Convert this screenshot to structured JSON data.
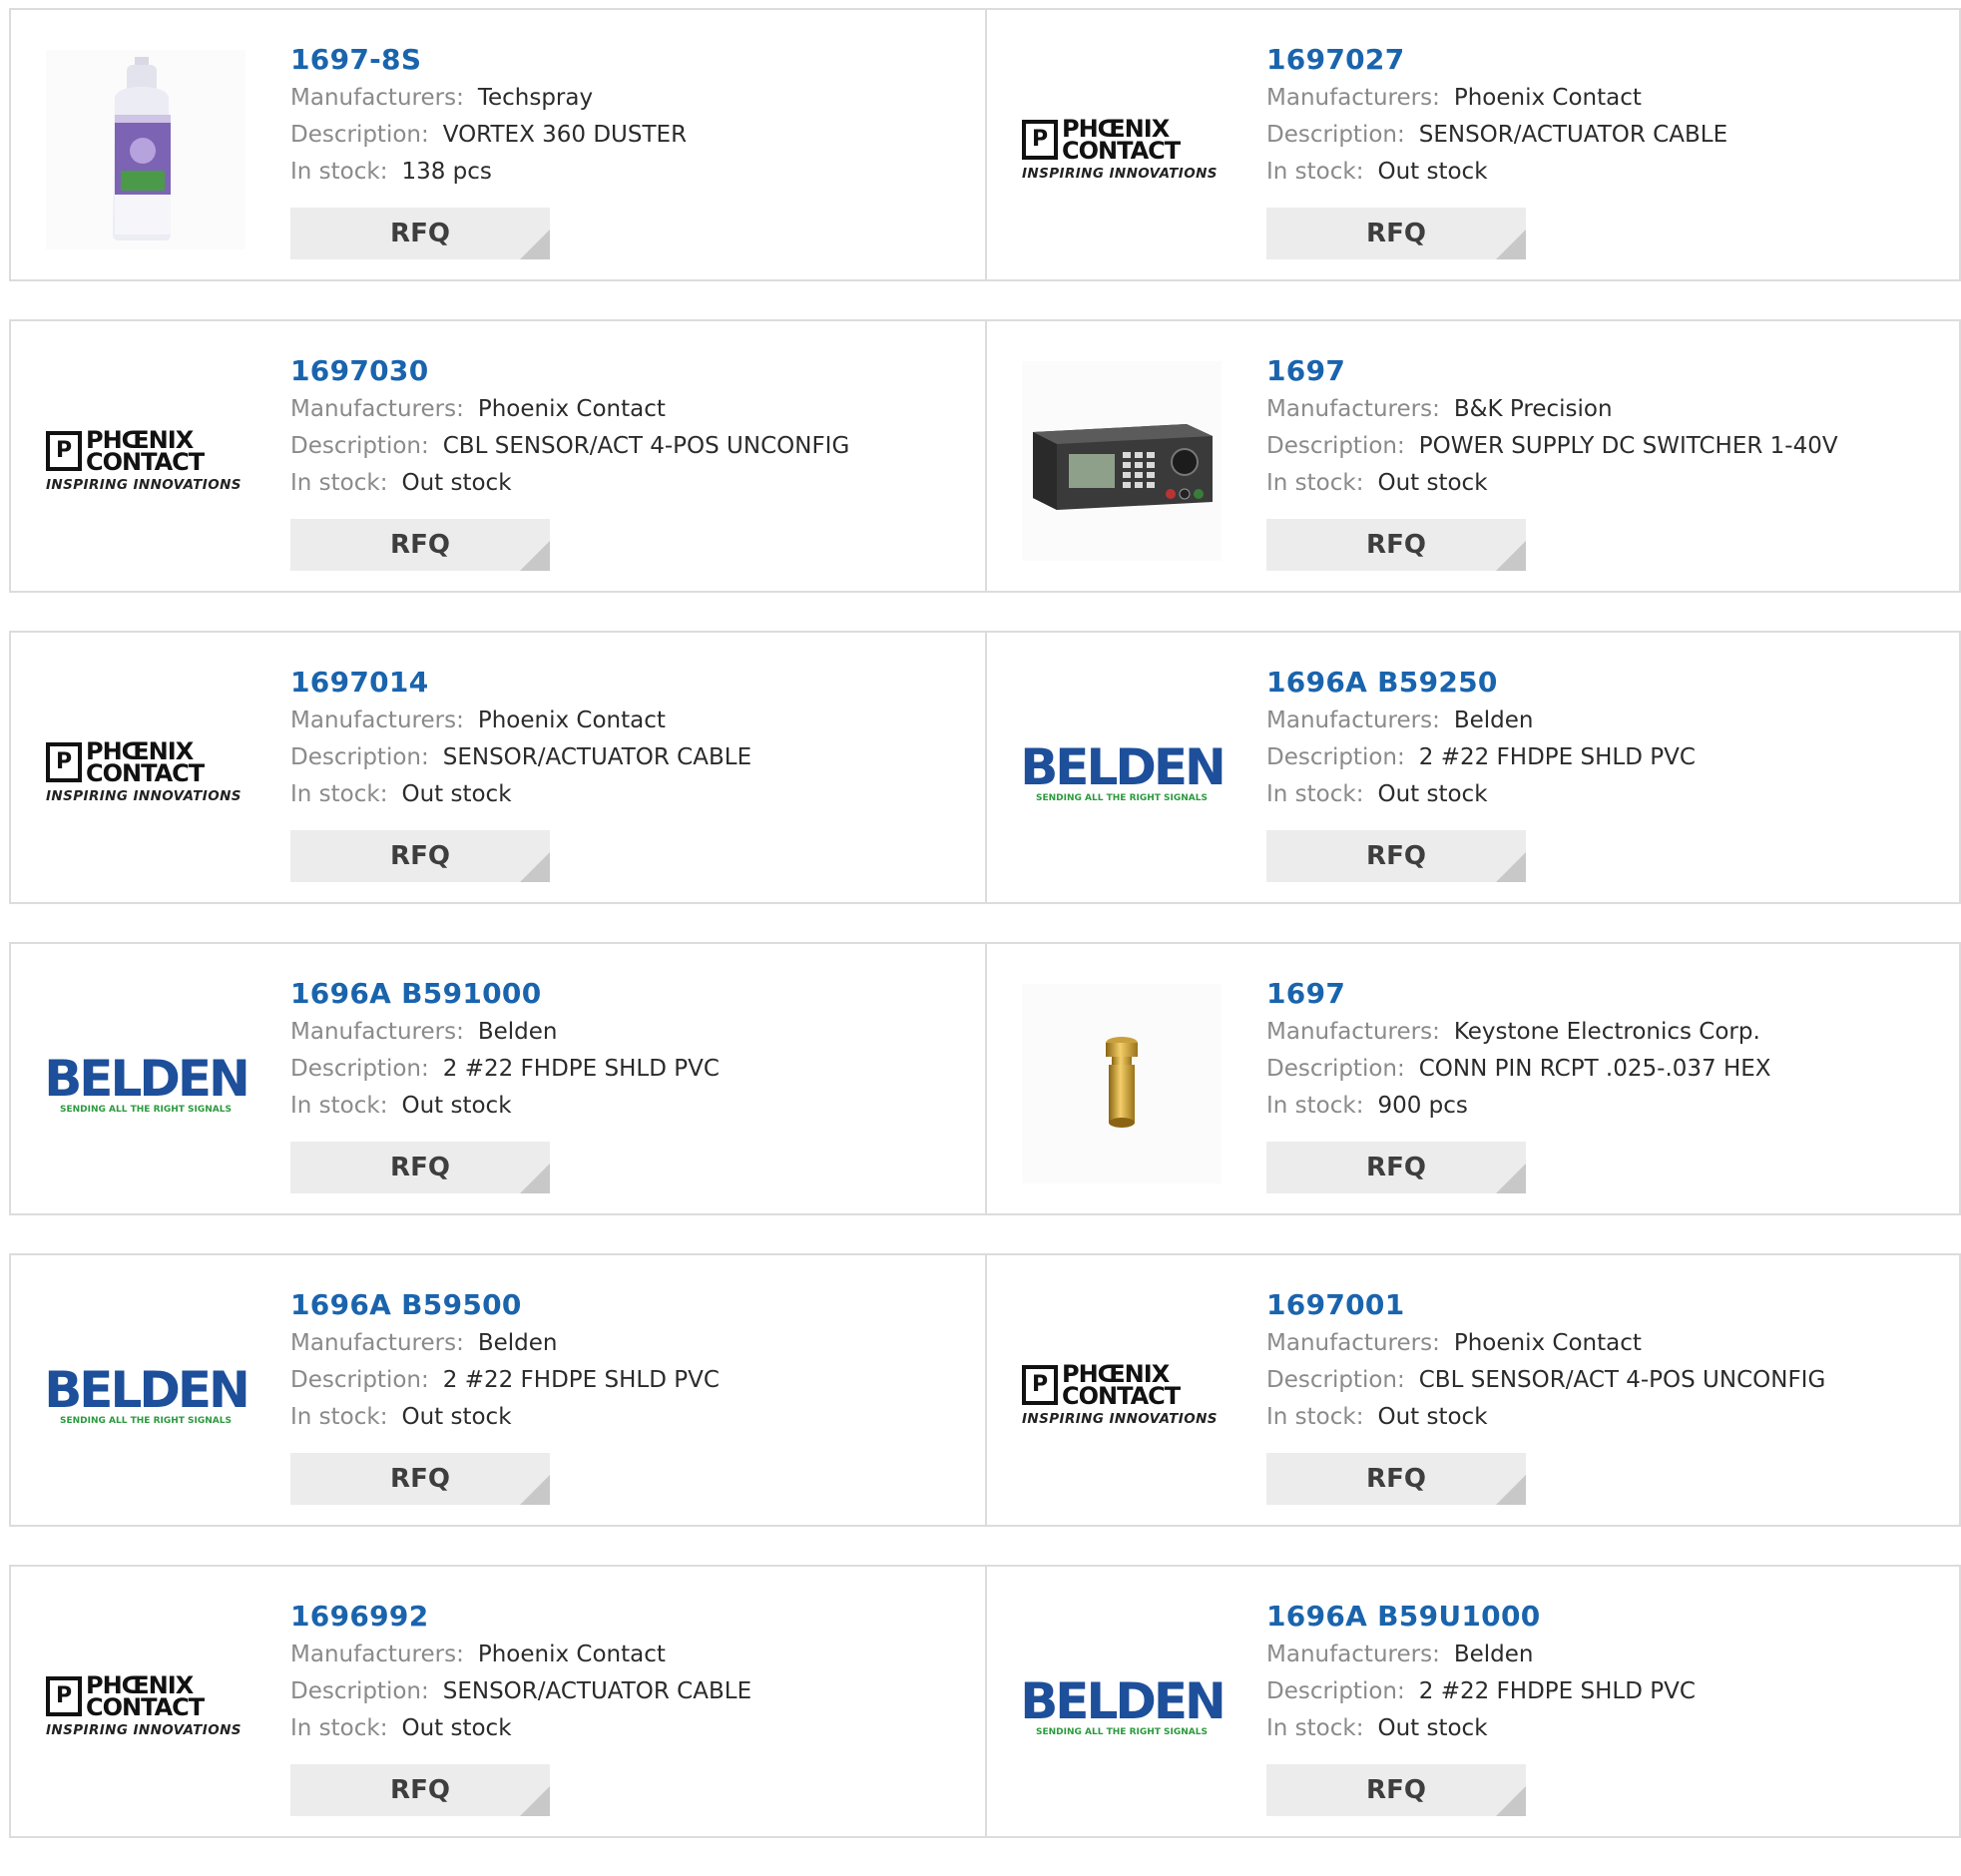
{
  "labels": {
    "manufacturers": "Manufacturers:",
    "description": "Description:",
    "stock": "In stock:",
    "rfq": "RFQ"
  },
  "logos": {
    "phoenix_line1": "PHŒNIX",
    "phoenix_line2": "CONTACT",
    "phoenix_tagline": "INSPIRING INNOVATIONS",
    "belden_word": "BELDEN",
    "belden_tagline": "SENDING ALL THE RIGHT SIGNALS"
  },
  "colors": {
    "part_link": "#1a64ad",
    "label_gray": "#8a8a8a",
    "value_dark": "#2b2b2b",
    "rfq_bg": "#ececec",
    "border": "#dcdcdc"
  },
  "products": [
    {
      "part": "1697-8S",
      "manufacturer": "Techspray",
      "description": "VORTEX 360 DUSTER",
      "stock": "138 pcs",
      "image": "spray-can-photo"
    },
    {
      "part": "1697027",
      "manufacturer": "Phoenix Contact",
      "description": "SENSOR/ACTUATOR CABLE",
      "stock": "Out stock",
      "image": "phoenix-contact-logo"
    },
    {
      "part": "1697030",
      "manufacturer": "Phoenix Contact",
      "description": "CBL SENSOR/ACT 4-POS UNCONFIG",
      "stock": "Out stock",
      "image": "phoenix-contact-logo"
    },
    {
      "part": "1697",
      "manufacturer": "B&K Precision",
      "description": "POWER SUPPLY DC SWITCHER 1-40V",
      "stock": "Out stock",
      "image": "power-supply-photo"
    },
    {
      "part": "1697014",
      "manufacturer": "Phoenix Contact",
      "description": "SENSOR/ACTUATOR CABLE",
      "stock": "Out stock",
      "image": "phoenix-contact-logo"
    },
    {
      "part": "1696A B59250",
      "manufacturer": "Belden",
      "description": "2 #22 FHDPE SHLD PVC",
      "stock": "Out stock",
      "image": "belden-logo"
    },
    {
      "part": "1696A B591000",
      "manufacturer": "Belden",
      "description": "2 #22 FHDPE SHLD PVC",
      "stock": "Out stock",
      "image": "belden-logo"
    },
    {
      "part": "1697",
      "manufacturer": "Keystone Electronics Corp.",
      "description": "CONN PIN RCPT .025-.037 HEX",
      "stock": "900 pcs",
      "image": "brass-pin-photo"
    },
    {
      "part": "1696A B59500",
      "manufacturer": "Belden",
      "description": "2 #22 FHDPE SHLD PVC",
      "stock": "Out stock",
      "image": "belden-logo"
    },
    {
      "part": "1697001",
      "manufacturer": "Phoenix Contact",
      "description": "CBL SENSOR/ACT 4-POS UNCONFIG",
      "stock": "Out stock",
      "image": "phoenix-contact-logo"
    },
    {
      "part": "1696992",
      "manufacturer": "Phoenix Contact",
      "description": "SENSOR/ACTUATOR CABLE",
      "stock": "Out stock",
      "image": "phoenix-contact-logo"
    },
    {
      "part": "1696A B59U1000",
      "manufacturer": "Belden",
      "description": "2 #22 FHDPE SHLD PVC",
      "stock": "Out stock",
      "image": "belden-logo"
    }
  ]
}
